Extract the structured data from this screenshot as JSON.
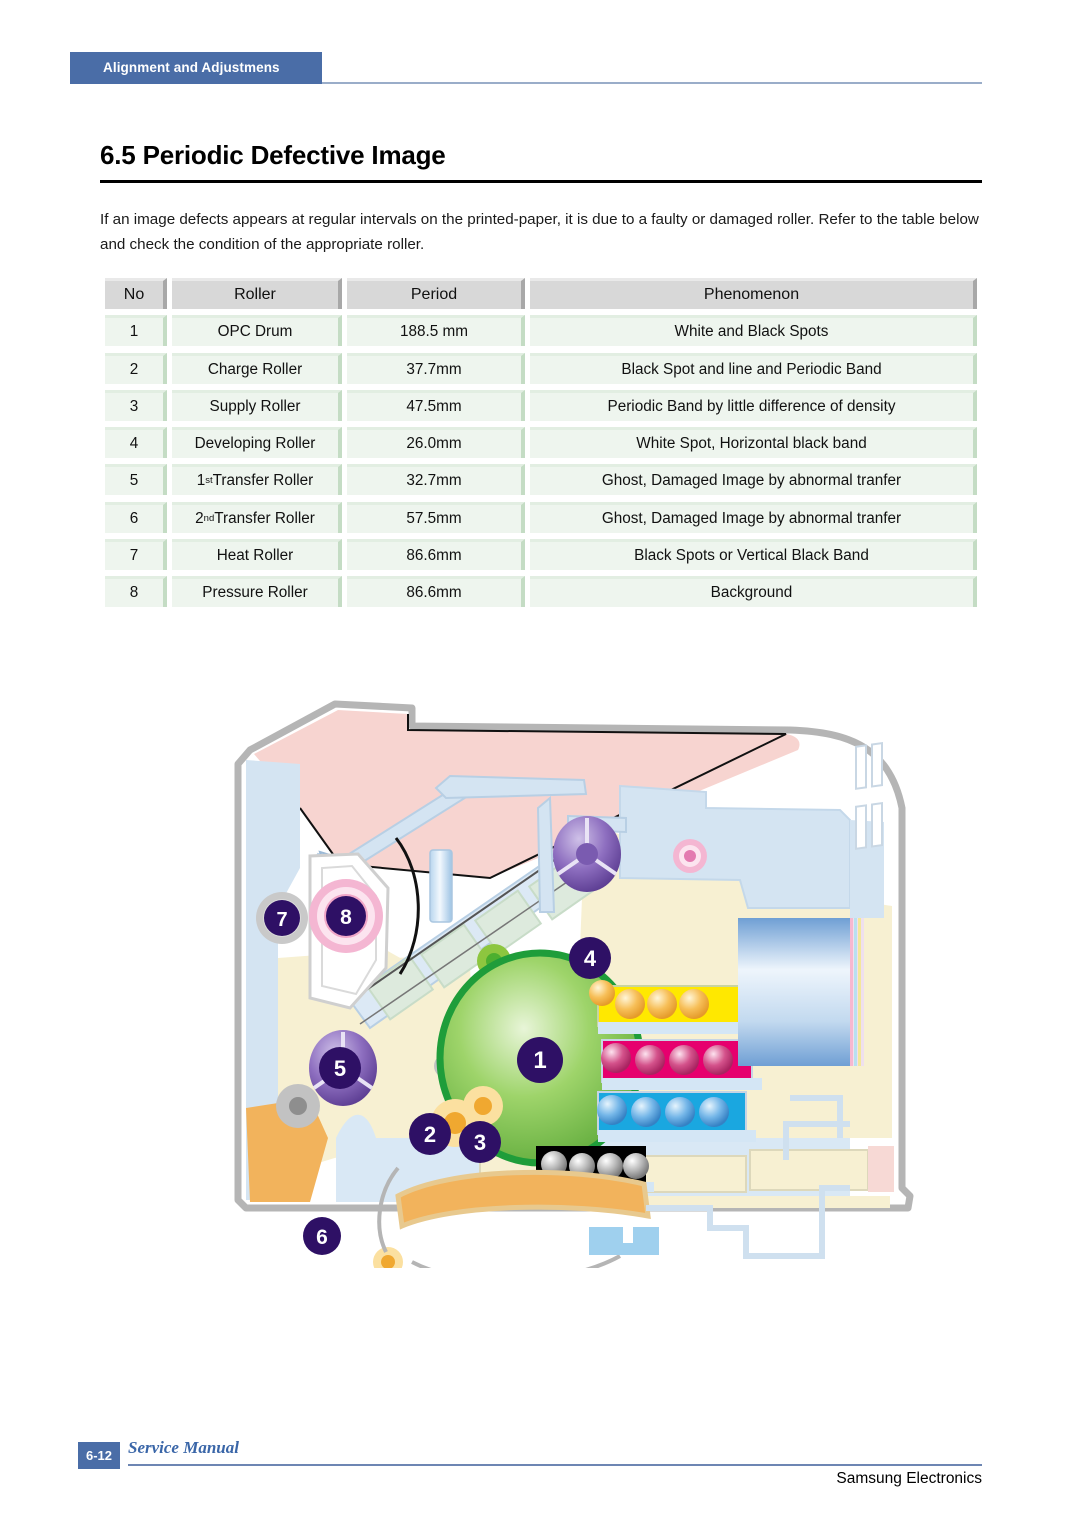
{
  "header": {
    "tab_label": "Alignment and Adjustmens"
  },
  "section": {
    "title": "6.5 Periodic Defective Image",
    "intro": "If an image defects appears at regular intervals on the printed-paper, it is due to a faulty or damaged roller. Refer to the table below and check the condition of the appropriate roller."
  },
  "table": {
    "columns": [
      "No",
      "Roller",
      "Period",
      "Phenomenon"
    ],
    "rows": [
      {
        "no": "1",
        "roller": "OPC Drum",
        "roller_sup": "",
        "roller_rest": "",
        "period": "188.5 mm",
        "phenomenon": "White and Black Spots"
      },
      {
        "no": "2",
        "roller": "Charge Roller",
        "roller_sup": "",
        "roller_rest": "",
        "period": "37.7mm",
        "phenomenon": "Black Spot and line and Periodic Band"
      },
      {
        "no": "3",
        "roller": "Supply Roller",
        "roller_sup": "",
        "roller_rest": "",
        "period": "47.5mm",
        "phenomenon": "Periodic Band by little difference of density"
      },
      {
        "no": "4",
        "roller": "Developing Roller",
        "roller_sup": "",
        "roller_rest": "",
        "period": "26.0mm",
        "phenomenon": "White Spot, Horizontal black band"
      },
      {
        "no": "5",
        "roller": "1",
        "roller_sup": "st",
        "roller_rest": " Transfer Roller",
        "period": "32.7mm",
        "phenomenon": "Ghost, Damaged Image by abnormal  tranfer"
      },
      {
        "no": "6",
        "roller": "2",
        "roller_sup": "nd",
        "roller_rest": " Transfer Roller",
        "period": "57.5mm",
        "phenomenon": "Ghost, Damaged Image by abnormal  tranfer"
      },
      {
        "no": "7",
        "roller": "Heat Roller",
        "roller_sup": "",
        "roller_rest": "",
        "period": "86.6mm",
        "phenomenon": "Black Spots or Vertical Black Band"
      },
      {
        "no": "8",
        "roller": "Pressure Roller",
        "roller_sup": "",
        "roller_rest": "",
        "period": "86.6mm",
        "phenomenon": "Background"
      }
    ]
  },
  "diagram": {
    "callouts": [
      {
        "id": "1",
        "label": "OPC Drum"
      },
      {
        "id": "2",
        "label": "Charge Roller"
      },
      {
        "id": "3",
        "label": "Supply Roller"
      },
      {
        "id": "4",
        "label": "Developing Roller"
      },
      {
        "id": "5",
        "label": "1st Transfer Roller"
      },
      {
        "id": "6",
        "label": "2nd Transfer Roller"
      },
      {
        "id": "7",
        "label": "Heat Roller"
      },
      {
        "id": "8",
        "label": "Pressure Roller"
      }
    ],
    "colors": {
      "callout": "#2e1065",
      "opc_drum": "#6cb544",
      "opc_drum_ring": "#1f9d3a",
      "casing_outline": "#b0b0b0",
      "panel_cream": "#f7f0d2",
      "panel_blue": "#d4e4f2",
      "panel_pink": "#f7d4d0",
      "panel_orange": "#f2b35c",
      "roller_purple": "#7a5bb0",
      "toner_yellow": "#ffe800",
      "toner_magenta": "#e6006e",
      "toner_cyan": "#1aa7e0",
      "toner_black": "#000000"
    }
  },
  "footer": {
    "page_number": "6-12",
    "manual_label": "Service Manual",
    "brand": "Samsung Electronics"
  },
  "colors": {
    "header_blue": "#4a6da7",
    "table_header_gray": "#d8d8d8",
    "table_row_green": "#eef5ee"
  }
}
